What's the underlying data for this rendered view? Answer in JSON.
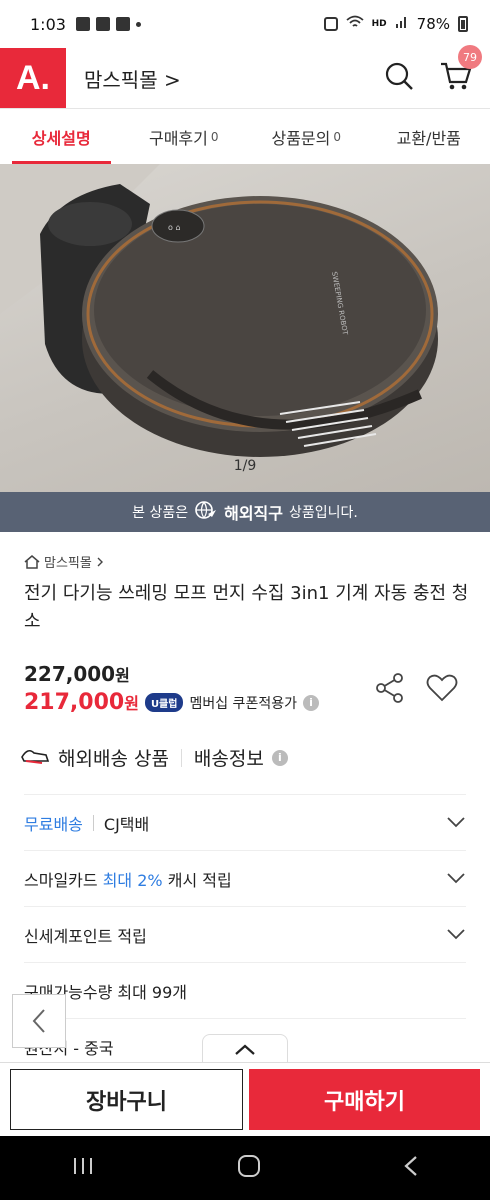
{
  "status_bar": {
    "time": "1:03",
    "battery": "78%",
    "network": "HD"
  },
  "header": {
    "logo": "A.",
    "store_name": "맘스픽몰 >",
    "cart_count": "79"
  },
  "tabs": [
    {
      "label": "상세설명",
      "count": ""
    },
    {
      "label": "구매후기",
      "count": "0"
    },
    {
      "label": "상품문의",
      "count": "0"
    },
    {
      "label": "교환/반품",
      "count": ""
    }
  ],
  "gallery": {
    "counter": "1/9",
    "product_marking": "SWEEPING ROBOT"
  },
  "overseas_banner": {
    "prefix": "본 상품은",
    "highlight": "해외직구",
    "suffix": "상품입니다."
  },
  "product": {
    "breadcrumb": "맘스픽몰",
    "title": "전기 다기능 쓰레밍 모프 먼지 수집 3in1 기계 자동 충전 청소",
    "price_original": "227,000",
    "price_sale": "217,000",
    "currency": "원",
    "uclub_badge": "U클럽",
    "member_text": "멤버십 쿠폰적용가"
  },
  "shipping": {
    "overseas_label": "해외배송 상품",
    "info_label": "배송정보"
  },
  "info_rows": {
    "delivery": {
      "free": "무료배송",
      "carrier": "CJ택배"
    },
    "smilecard": {
      "prefix": "스마일카드",
      "highlight": "최대 2%",
      "suffix": "캐시 적립"
    },
    "points": "신세계포인트 적립",
    "max_qty": "구매가능수량 최대 99개",
    "origin": "원산지 - 중국"
  },
  "bottom": {
    "cart_label": "장바구니",
    "buy_label": "구매하기"
  },
  "colors": {
    "brand": "#e8293a",
    "banner": "#586274",
    "link_blue": "#2f7de1"
  }
}
